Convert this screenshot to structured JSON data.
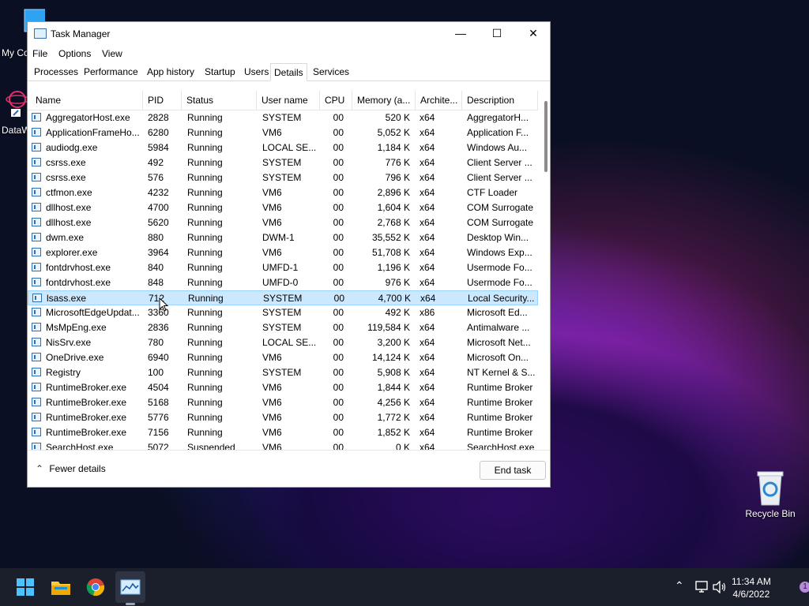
{
  "desktop": {
    "icons": [
      {
        "label": "My Co",
        "icon": "computer-icon"
      },
      {
        "label": "DataW",
        "icon": "shortcut-icon"
      },
      {
        "label": "Recycle Bin",
        "icon": "recycle-bin-icon"
      }
    ]
  },
  "window": {
    "title": "Task Manager",
    "controls": {
      "minimize": "—",
      "maximize": "☐",
      "close": "✕"
    }
  },
  "menu": [
    "File",
    "Options",
    "View"
  ],
  "tabs": [
    "Processes",
    "Performance",
    "App history",
    "Startup",
    "Users",
    "Details",
    "Services"
  ],
  "active_tab": "Details",
  "columns": [
    "Name",
    "PID",
    "Status",
    "User name",
    "CPU",
    "Memory (a...",
    "Archite...",
    "Description"
  ],
  "rows": [
    {
      "name": "AggregatorHost.exe",
      "pid": "2828",
      "status": "Running",
      "user": "SYSTEM",
      "cpu": "00",
      "mem": "520 K",
      "arch": "x64",
      "desc": "AggregatorH..."
    },
    {
      "name": "ApplicationFrameHo...",
      "pid": "6280",
      "status": "Running",
      "user": "VM6",
      "cpu": "00",
      "mem": "5,052 K",
      "arch": "x64",
      "desc": "Application F..."
    },
    {
      "name": "audiodg.exe",
      "pid": "5984",
      "status": "Running",
      "user": "LOCAL SE...",
      "cpu": "00",
      "mem": "1,184 K",
      "arch": "x64",
      "desc": "Windows Au..."
    },
    {
      "name": "csrss.exe",
      "pid": "492",
      "status": "Running",
      "user": "SYSTEM",
      "cpu": "00",
      "mem": "776 K",
      "arch": "x64",
      "desc": "Client Server ..."
    },
    {
      "name": "csrss.exe",
      "pid": "576",
      "status": "Running",
      "user": "SYSTEM",
      "cpu": "00",
      "mem": "796 K",
      "arch": "x64",
      "desc": "Client Server ..."
    },
    {
      "name": "ctfmon.exe",
      "pid": "4232",
      "status": "Running",
      "user": "VM6",
      "cpu": "00",
      "mem": "2,896 K",
      "arch": "x64",
      "desc": "CTF Loader"
    },
    {
      "name": "dllhost.exe",
      "pid": "4700",
      "status": "Running",
      "user": "VM6",
      "cpu": "00",
      "mem": "1,604 K",
      "arch": "x64",
      "desc": "COM Surrogate"
    },
    {
      "name": "dllhost.exe",
      "pid": "5620",
      "status": "Running",
      "user": "VM6",
      "cpu": "00",
      "mem": "2,768 K",
      "arch": "x64",
      "desc": "COM Surrogate"
    },
    {
      "name": "dwm.exe",
      "pid": "880",
      "status": "Running",
      "user": "DWM-1",
      "cpu": "00",
      "mem": "35,552 K",
      "arch": "x64",
      "desc": "Desktop Win..."
    },
    {
      "name": "explorer.exe",
      "pid": "3964",
      "status": "Running",
      "user": "VM6",
      "cpu": "00",
      "mem": "51,708 K",
      "arch": "x64",
      "desc": "Windows Exp..."
    },
    {
      "name": "fontdrvhost.exe",
      "pid": "840",
      "status": "Running",
      "user": "UMFD-1",
      "cpu": "00",
      "mem": "1,196 K",
      "arch": "x64",
      "desc": "Usermode Fo..."
    },
    {
      "name": "fontdrvhost.exe",
      "pid": "848",
      "status": "Running",
      "user": "UMFD-0",
      "cpu": "00",
      "mem": "976 K",
      "arch": "x64",
      "desc": "Usermode Fo..."
    },
    {
      "name": "lsass.exe",
      "pid": "712",
      "status": "Running",
      "user": "SYSTEM",
      "cpu": "00",
      "mem": "4,700 K",
      "arch": "x64",
      "desc": "Local Security...",
      "selected": true
    },
    {
      "name": "MicrosoftEdgeUpdat...",
      "pid": "3360",
      "status": "Running",
      "user": "SYSTEM",
      "cpu": "00",
      "mem": "492 K",
      "arch": "x86",
      "desc": "Microsoft Ed..."
    },
    {
      "name": "MsMpEng.exe",
      "pid": "2836",
      "status": "Running",
      "user": "SYSTEM",
      "cpu": "00",
      "mem": "119,584 K",
      "arch": "x64",
      "desc": "Antimalware ..."
    },
    {
      "name": "NisSrv.exe",
      "pid": "780",
      "status": "Running",
      "user": "LOCAL SE...",
      "cpu": "00",
      "mem": "3,200 K",
      "arch": "x64",
      "desc": "Microsoft Net..."
    },
    {
      "name": "OneDrive.exe",
      "pid": "6940",
      "status": "Running",
      "user": "VM6",
      "cpu": "00",
      "mem": "14,124 K",
      "arch": "x64",
      "desc": "Microsoft On..."
    },
    {
      "name": "Registry",
      "pid": "100",
      "status": "Running",
      "user": "SYSTEM",
      "cpu": "00",
      "mem": "5,908 K",
      "arch": "x64",
      "desc": "NT Kernel & S..."
    },
    {
      "name": "RuntimeBroker.exe",
      "pid": "4504",
      "status": "Running",
      "user": "VM6",
      "cpu": "00",
      "mem": "1,844 K",
      "arch": "x64",
      "desc": "Runtime Broker"
    },
    {
      "name": "RuntimeBroker.exe",
      "pid": "5168",
      "status": "Running",
      "user": "VM6",
      "cpu": "00",
      "mem": "4,256 K",
      "arch": "x64",
      "desc": "Runtime Broker"
    },
    {
      "name": "RuntimeBroker.exe",
      "pid": "5776",
      "status": "Running",
      "user": "VM6",
      "cpu": "00",
      "mem": "1,772 K",
      "arch": "x64",
      "desc": "Runtime Broker"
    },
    {
      "name": "RuntimeBroker.exe",
      "pid": "7156",
      "status": "Running",
      "user": "VM6",
      "cpu": "00",
      "mem": "1,852 K",
      "arch": "x64",
      "desc": "Runtime Broker"
    },
    {
      "name": "SearchHost.exe",
      "pid": "5072",
      "status": "Suspended",
      "user": "VM6",
      "cpu": "00",
      "mem": "0 K",
      "arch": "x64",
      "desc": "SearchHost.exe"
    }
  ],
  "footer": {
    "fewer_details": "Fewer details",
    "end_task": "End task"
  },
  "taskbar": {
    "apps": [
      "start-icon",
      "file-explorer-icon",
      "chrome-icon",
      "task-manager-icon"
    ],
    "time": "11:34 AM",
    "date": "4/6/2022",
    "notification_count": "1"
  },
  "colors": {
    "selection": "#cce8ff",
    "taskbar": "#1b1f2b"
  }
}
